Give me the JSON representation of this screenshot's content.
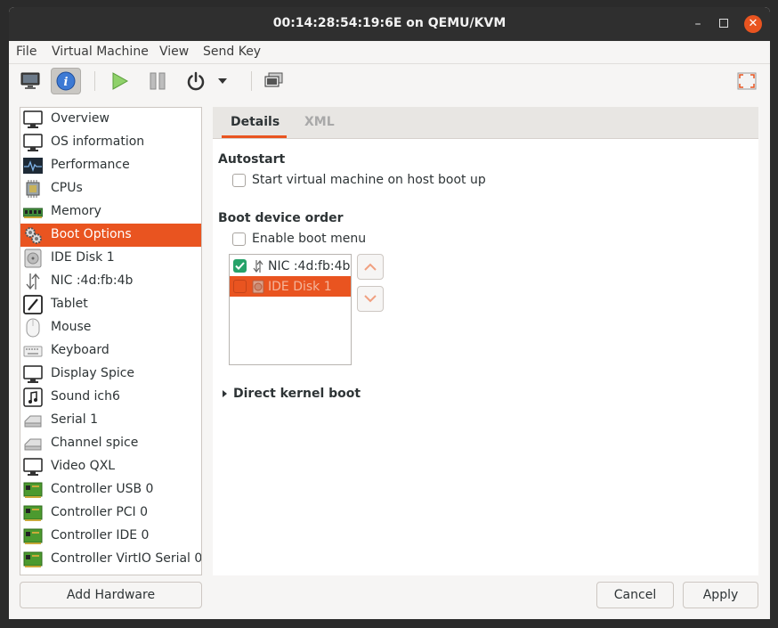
{
  "window": {
    "title": "00:14:28:54:19:6E on QEMU/KVM"
  },
  "menubar": {
    "file": "File",
    "virtual_machine": "Virtual Machine",
    "view": "View",
    "send_key": "Send Key"
  },
  "toolbar": {
    "buttons": [
      "console-icon",
      "info-icon",
      "run-icon",
      "pause-icon",
      "power-icon",
      "power-menu-icon",
      "snapshot-icon",
      "fullscreen-icon"
    ]
  },
  "sidebar": {
    "items": [
      {
        "label": "Overview",
        "icon": "monitor-icon"
      },
      {
        "label": "OS information",
        "icon": "monitor-icon"
      },
      {
        "label": "Performance",
        "icon": "performance-icon"
      },
      {
        "label": "CPUs",
        "icon": "cpu-icon"
      },
      {
        "label": "Memory",
        "icon": "memory-icon"
      },
      {
        "label": "Boot Options",
        "icon": "gears-icon"
      },
      {
        "label": "IDE Disk 1",
        "icon": "disk-icon"
      },
      {
        "label": "NIC :4d:fb:4b",
        "icon": "network-icon"
      },
      {
        "label": "Tablet",
        "icon": "tablet-icon"
      },
      {
        "label": "Mouse",
        "icon": "mouse-icon"
      },
      {
        "label": "Keyboard",
        "icon": "keyboard-icon"
      },
      {
        "label": "Display Spice",
        "icon": "monitor-icon"
      },
      {
        "label": "Sound ich6",
        "icon": "sound-icon"
      },
      {
        "label": "Serial 1",
        "icon": "serial-icon"
      },
      {
        "label": "Channel spice",
        "icon": "serial-icon"
      },
      {
        "label": "Video QXL",
        "icon": "monitor-icon"
      },
      {
        "label": "Controller USB 0",
        "icon": "controller-icon"
      },
      {
        "label": "Controller PCI 0",
        "icon": "controller-icon"
      },
      {
        "label": "Controller IDE 0",
        "icon": "controller-icon"
      },
      {
        "label": "Controller VirtIO Serial 0",
        "icon": "controller-icon"
      }
    ],
    "selected": "Boot Options"
  },
  "tabs": {
    "details": "Details",
    "xml": "XML",
    "active": "Details"
  },
  "autostart": {
    "heading": "Autostart",
    "checkbox_label": "Start virtual machine on host boot up",
    "checked": false
  },
  "boot_order": {
    "heading": "Boot device order",
    "enable_menu_label": "Enable boot menu",
    "enable_menu_checked": false,
    "devices": [
      {
        "label": "NIC :4d:fb:4b",
        "checked": true,
        "icon": "network-icon"
      },
      {
        "label": "IDE Disk 1",
        "checked": false,
        "icon": "disk-icon",
        "selected": true
      }
    ]
  },
  "direct_kernel": {
    "label": "Direct kernel boot"
  },
  "buttons": {
    "add_hardware": "Add Hardware",
    "cancel": "Cancel",
    "apply": "Apply"
  },
  "colors": {
    "accent": "#e95420",
    "titlebar": "#2f2f2f",
    "check_green": "#26a269"
  }
}
